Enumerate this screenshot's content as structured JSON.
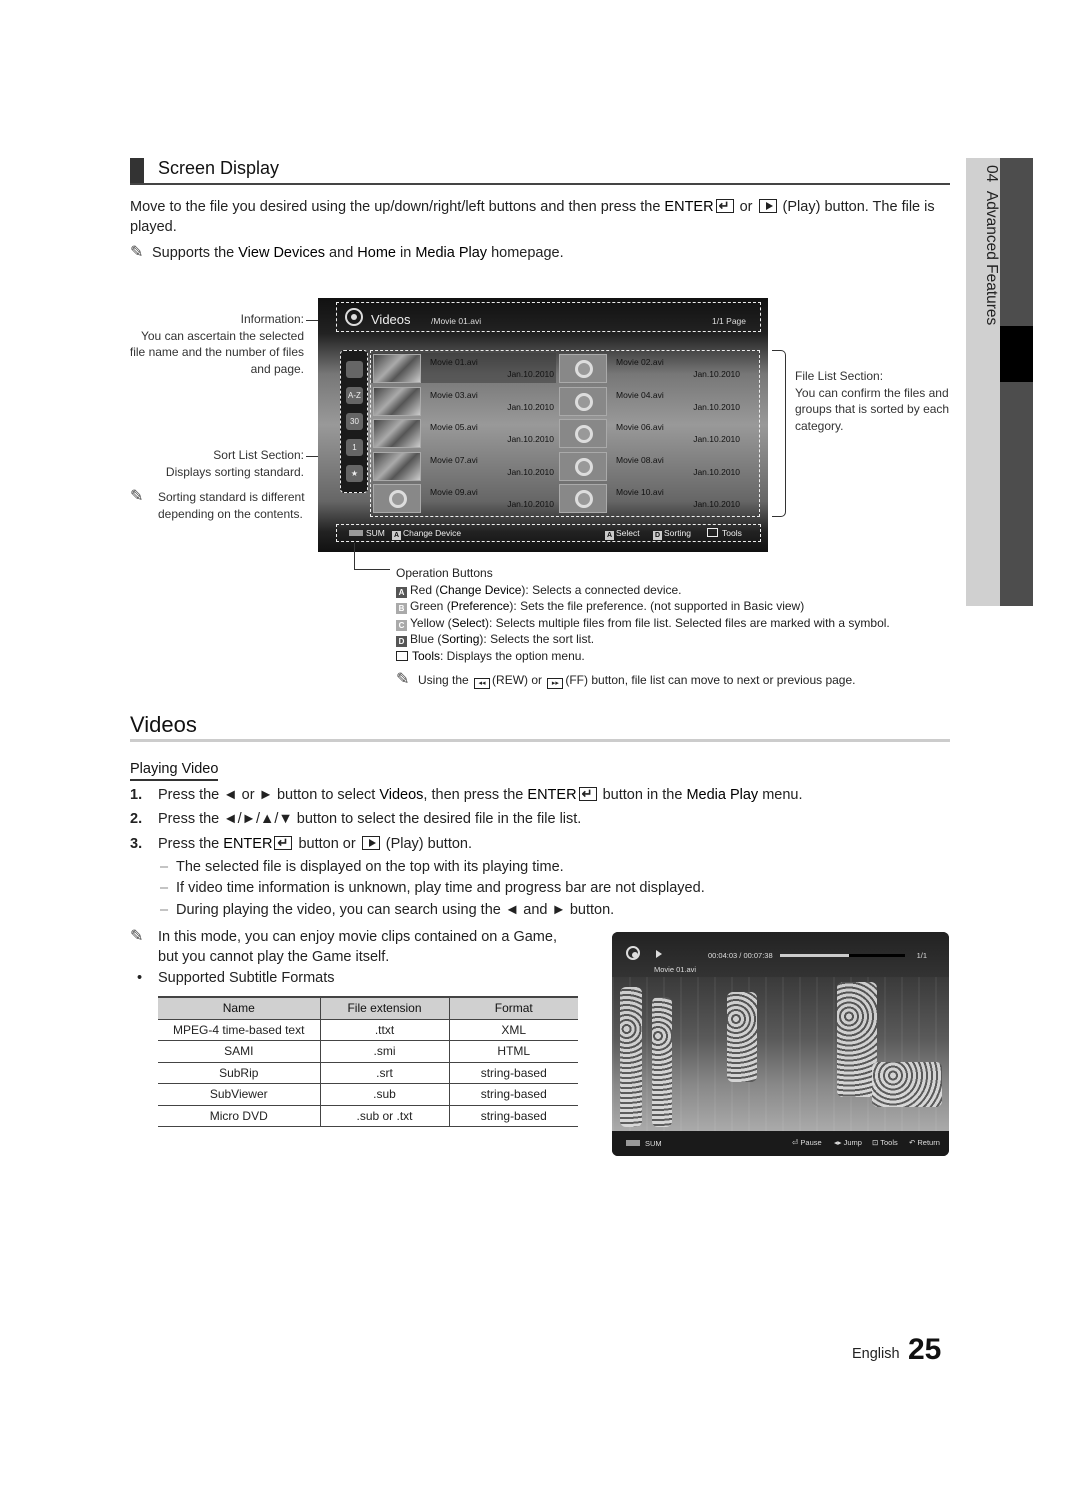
{
  "side_tab": {
    "chapter": "04",
    "title": "Advanced Features"
  },
  "screen_display": {
    "heading": "Screen Display",
    "intro_part1": "Move to the file you desired using the up/down/right/left buttons and then press the ",
    "enter_label": "ENTER",
    "or": " or ",
    "intro_part2": " (Play) button. The file is played.",
    "note_pre": "Supports the ",
    "note_view_devices": "View Devices",
    "note_and": " and ",
    "note_home": "Home",
    "note_in": " in ",
    "note_media_play": "Media Play",
    "note_post": " homepage."
  },
  "annotations": {
    "information_title": "Information:",
    "information_desc": "You can ascertain the selected file name and the number of files and page.",
    "sort_title": "Sort List Section:",
    "sort_desc": "Displays sorting standard.",
    "sort_note": "Sorting standard is different depending on the contents.",
    "file_list_title": "File List Section:",
    "file_list_desc": "You can confirm the files and groups that is sorted by each category."
  },
  "tv_screen": {
    "title": "Videos",
    "path": "/Movie 01.avi",
    "page": "1/1 Page",
    "sort_icons": [
      "folder-icon",
      "a-z-icon",
      "calendar-30-icon",
      "calendar-month-icon",
      "star-icon"
    ],
    "sort_labels": [
      "",
      "A-Z",
      "30",
      "1",
      "★"
    ],
    "files": [
      {
        "name": "Movie 01.avi",
        "date": "Jan.10.2010",
        "selected": true
      },
      {
        "name": "Movie 02.avi",
        "date": "Jan.10.2010"
      },
      {
        "name": "Movie 03.avi",
        "date": "Jan.10.2010"
      },
      {
        "name": "Movie 04.avi",
        "date": "Jan.10.2010"
      },
      {
        "name": "Movie 05.avi",
        "date": "Jan.10.2010"
      },
      {
        "name": "Movie 06.avi",
        "date": "Jan.10.2010"
      },
      {
        "name": "Movie 07.avi",
        "date": "Jan.10.2010"
      },
      {
        "name": "Movie 08.avi",
        "date": "Jan.10.2010"
      },
      {
        "name": "Movie 09.avi",
        "date": "Jan.10.2010"
      },
      {
        "name": "Movie 10.avi",
        "date": "Jan.10.2010"
      }
    ],
    "footer": {
      "device": "SUM",
      "change_device_key": "A",
      "change_device": "Change Device",
      "select_key": "A",
      "select": "Select",
      "sorting_key": "D",
      "sorting": "Sorting",
      "tools": "Tools"
    }
  },
  "operation_buttons": {
    "title": "Operation Buttons",
    "items": [
      {
        "key": "A",
        "color": "Red",
        "name": "Change Device",
        "desc": ": Selects a connected device."
      },
      {
        "key": "B",
        "color": "Green",
        "name": "Preference",
        "desc": ": Sets the file preference. (not supported in Basic view)"
      },
      {
        "key": "C",
        "color": "Yellow",
        "name": "Select",
        "desc": ": Selects multiple files from file list. Selected files are marked with a symbol."
      },
      {
        "key": "D",
        "color": "Blue",
        "name": "Sorting",
        "desc": ": Selects the sort list."
      }
    ],
    "tools_name": "Tools",
    "tools_desc": ": Displays the option menu.",
    "note_pre": "Using the ",
    "note_rew": "(REW) or ",
    "note_ff": "(FF) button, file list can move to next or previous page."
  },
  "videos": {
    "heading": "Videos",
    "subheading": "Playing Video",
    "steps": [
      {
        "num": "1.",
        "parts": [
          "Press the ◄ or ► button to select ",
          "Videos",
          ", then press the ",
          "ENTER",
          " button in the ",
          "Media Play",
          " menu."
        ]
      },
      {
        "num": "2.",
        "text": "Press the ◄/►/▲/▼ button to select the desired file in the file list."
      },
      {
        "num": "3.",
        "parts": [
          "Press the ",
          "ENTER",
          " button or ",
          " (Play) button."
        ]
      }
    ],
    "dashes": [
      "The selected file is displayed on the top with its playing time.",
      "If video time information is unknown, play time and progress bar are not displayed.",
      "During playing the video, you can search using the ◄ and ► button."
    ],
    "note": "In this mode, you can enjoy movie clips contained on a Game, but you cannot play the Game itself.",
    "bullet": "Supported Subtitle Formats",
    "table": {
      "headers": [
        "Name",
        "File extension",
        "Format"
      ],
      "rows": [
        [
          "MPEG-4 time-based text",
          ".ttxt",
          "XML"
        ],
        [
          "SAMI",
          ".smi",
          "HTML"
        ],
        [
          "SubRip",
          ".srt",
          "string-based"
        ],
        [
          "SubViewer",
          ".sub",
          "string-based"
        ],
        [
          "Micro DVD",
          ".sub or .txt",
          "string-based"
        ]
      ]
    }
  },
  "player": {
    "time": "00:04:03 / 00:07:38",
    "progress": 0.55,
    "count": "1/1",
    "file": "Movie 01.avi",
    "device": "SUM",
    "pause": "Pause",
    "jump": "Jump",
    "tools": "Tools",
    "return": "Return"
  },
  "footer": {
    "language": "English",
    "page": "25"
  }
}
